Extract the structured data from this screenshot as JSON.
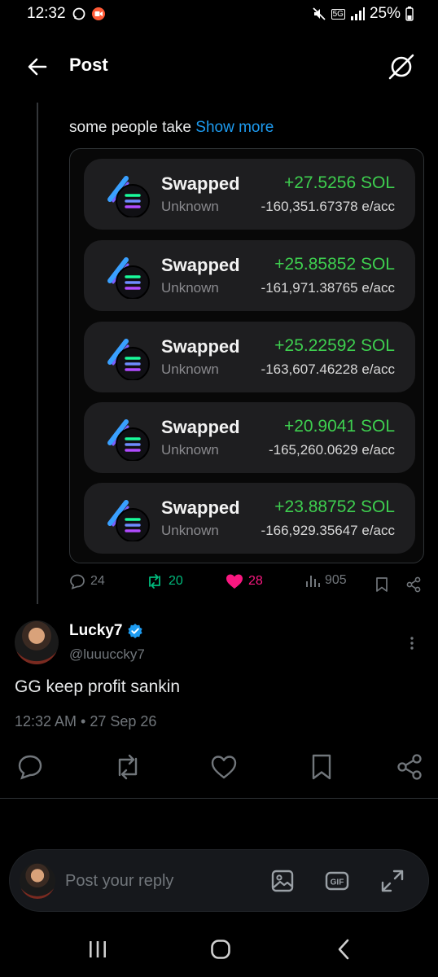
{
  "status_bar": {
    "time": "12:32",
    "network": "5G",
    "battery": "25%"
  },
  "header": {
    "title": "Post"
  },
  "post": {
    "text": "some people take ",
    "show_more": "Show more",
    "swaps": [
      {
        "title": "Swapped",
        "subtitle": "Unknown",
        "amount": "+27.5256 SOL",
        "price": "-160,351.67378 e/acc"
      },
      {
        "title": "Swapped",
        "subtitle": "Unknown",
        "amount": "+25.85852 SOL",
        "price": "-161,971.38765 e/acc"
      },
      {
        "title": "Swapped",
        "subtitle": "Unknown",
        "amount": "+25.22592 SOL",
        "price": "-163,607.46228 e/acc"
      },
      {
        "title": "Swapped",
        "subtitle": "Unknown",
        "amount": "+20.9041 SOL",
        "price": "-165,260.0629 e/acc"
      },
      {
        "title": "Swapped",
        "subtitle": "Unknown",
        "amount": "+23.88752 SOL",
        "price": "-166,929.35647 e/acc"
      }
    ],
    "stats": {
      "replies": "24",
      "reposts": "20",
      "likes": "28",
      "views": "905"
    },
    "colors": {
      "repost_active": "#00ba7c",
      "like_active": "#f91880",
      "gain_green": "#3ecf4f"
    }
  },
  "reply": {
    "author_name": "Lucky7",
    "author_handle": "@luuuccky7",
    "text": "GG keep profit sankin",
    "timestamp": "12:32 AM • 27 Sep 26"
  },
  "composer": {
    "placeholder": "Post your reply"
  }
}
